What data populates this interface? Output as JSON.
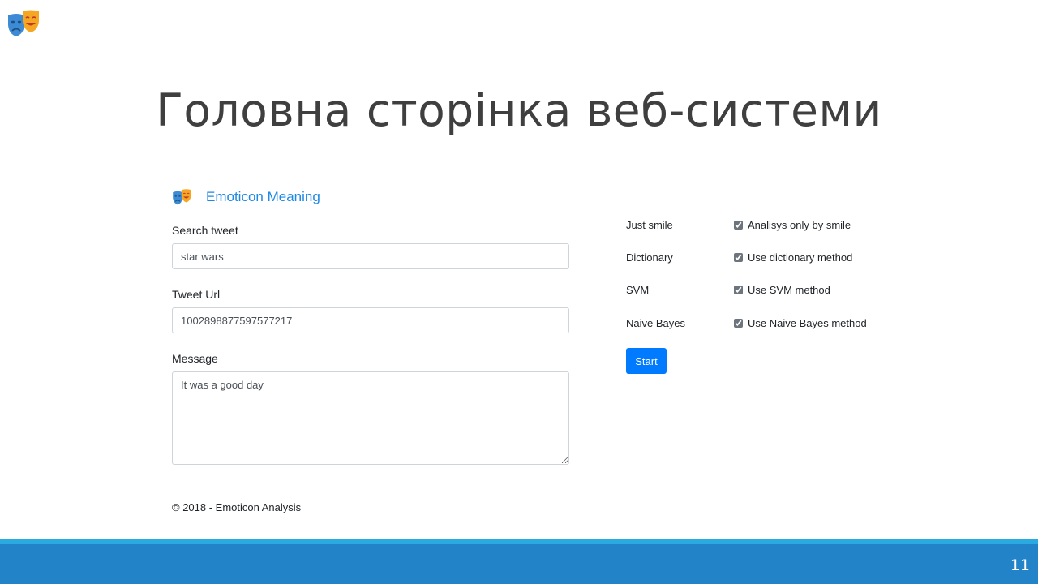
{
  "slide": {
    "title": "Головна сторінка веб-системи",
    "number": "11",
    "logo_icon": "theater-masks-icon"
  },
  "app": {
    "brand": "Emoticon Meaning",
    "brand_icon": "theater-masks-icon",
    "accent_color": "#1e88e5",
    "fields": {
      "search_tweet": {
        "label": "Search tweet",
        "value": "star wars"
      },
      "tweet_url": {
        "label": "Tweet Url",
        "value": "1002898877597577217"
      },
      "message": {
        "label": "Message",
        "value": "It was a good day"
      }
    },
    "options": [
      {
        "label": "Just smile",
        "check_label": "Analisys only by smile",
        "checked": true
      },
      {
        "label": "Dictionary",
        "check_label": "Use dictionary method",
        "checked": true
      },
      {
        "label": "SVM",
        "check_label": "Use SVM method",
        "checked": true
      },
      {
        "label": "Naive Bayes",
        "check_label": "Use Naive Bayes method",
        "checked": true
      }
    ],
    "start_label": "Start",
    "start_color": "#007bff",
    "footer": "© 2018 - Emoticon Analysis"
  },
  "colors": {
    "bottom_bar": "#2383c8",
    "bottom_bar_accent": "#29abe2"
  }
}
